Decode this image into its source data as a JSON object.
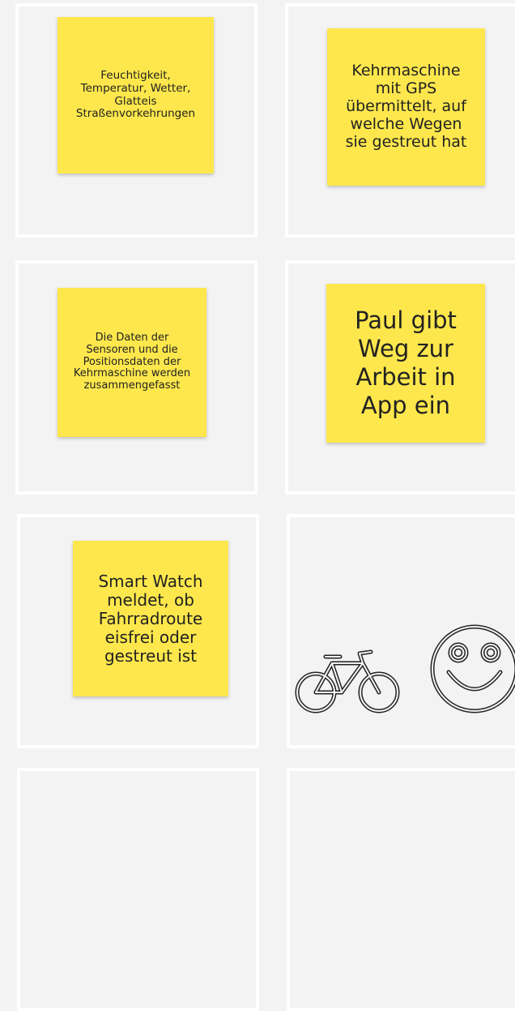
{
  "board": {
    "frames": [
      {
        "name": "frame-1-1"
      },
      {
        "name": "frame-1-2"
      },
      {
        "name": "frame-2-1"
      },
      {
        "name": "frame-2-2"
      },
      {
        "name": "frame-3-1"
      },
      {
        "name": "frame-3-2"
      },
      {
        "name": "frame-4-1"
      },
      {
        "name": "frame-4-2"
      }
    ]
  },
  "notes": {
    "n1": "Feuchtigkeit,\nTemperatur, Wetter,\nGlatteis\nStraßenvorkehrungen",
    "n2": "Kehrmaschine\nmit GPS\nübermittelt, auf\nwelche Wegen\nsie gestreut hat",
    "n3": "Die Daten der\nSensoren und die\nPositionsdaten der\nKehrmaschine werden\nzusammengefasst",
    "n4": "Paul gibt\nWeg zur\nArbeit in\nApp ein",
    "n5": "Smart Watch\nmeldet, ob\nFahrradroute\neisfrei oder\ngestreut ist"
  },
  "icons": {
    "bicycle": "bicycle-icon",
    "smiley": "smiley-icon"
  },
  "colors": {
    "canvas": "#f4f3f4",
    "frame_border": "#ffffff",
    "sticky": "#fde74c",
    "stroke": "#222222"
  }
}
